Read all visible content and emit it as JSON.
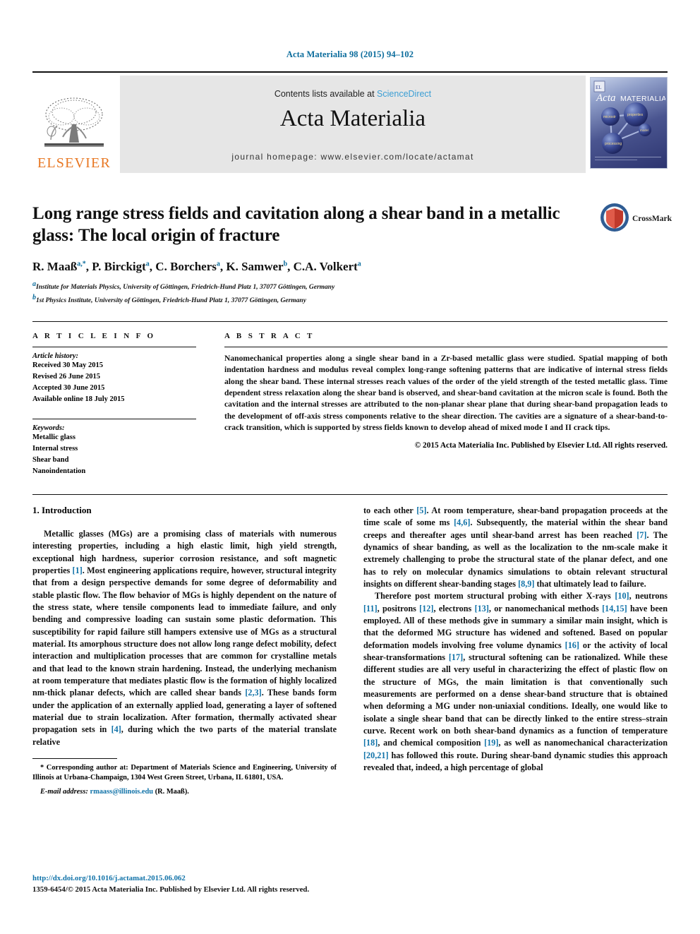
{
  "running_head": "Acta Materialia 98 (2015) 94–102",
  "masthead": {
    "publisher_logo_name": "elsevier-tree-logo",
    "publisher_wordmark": "ELSEVIER",
    "contents_prefix": "Contents lists available at ",
    "contents_link": "ScienceDirect",
    "journal_title": "Acta Materialia",
    "homepage": "journal homepage: www.elsevier.com/locate/actamat",
    "cover": {
      "brand_italic": "Acta",
      "brand_caps": "MATERIALIA",
      "node_labels": [
        "microstructure",
        "properties",
        "modeling",
        "processing"
      ]
    },
    "colors": {
      "link": "#3b9ed4",
      "elsevier_orange": "#e87722",
      "band_bg": "#e6e6e6"
    }
  },
  "title_block": {
    "title": "Long range stress fields and cavitation along a shear band in a metallic glass: The local origin of fracture",
    "crossmark_label": "CrossMark",
    "authors": [
      {
        "name": "R. Maaß",
        "marks": "a,*"
      },
      {
        "name": "P. Birckigt",
        "marks": "a"
      },
      {
        "name": "C. Borchers",
        "marks": "a"
      },
      {
        "name": "K. Samwer",
        "marks": "b"
      },
      {
        "name": "C.A. Volkert",
        "marks": "a"
      }
    ],
    "affiliations": [
      {
        "mark": "a",
        "text": "Institute for Materials Physics, University of Göttingen, Friedrich-Hund Platz 1, 37077 Göttingen, Germany"
      },
      {
        "mark": "b",
        "text": "1st Physics Institute, University of Göttingen, Friedrich-Hund Platz 1, 37077 Göttingen, Germany"
      }
    ]
  },
  "article_info": {
    "heading": "A R T I C L E   I N F O",
    "history_label": "Article history:",
    "history": [
      "Received 30 May 2015",
      "Revised 26 June 2015",
      "Accepted 30 June 2015",
      "Available online 18 July 2015"
    ],
    "keywords_label": "Keywords:",
    "keywords": [
      "Metallic glass",
      "Internal stress",
      "Shear band",
      "Nanoindentation"
    ]
  },
  "abstract": {
    "heading": "A B S T R A C T",
    "text": "Nanomechanical properties along a single shear band in a Zr-based metallic glass were studied. Spatial mapping of both indentation hardness and modulus reveal complex long-range softening patterns that are indicative of internal stress fields along the shear band. These internal stresses reach values of the order of the yield strength of the tested metallic glass. Time dependent stress relaxation along the shear band is observed, and shear-band cavitation at the micron scale is found. Both the cavitation and the internal stresses are attributed to the non-planar shear plane that during shear-band propagation leads to the development of off-axis stress components relative to the shear direction. The cavities are a signature of a shear-band-to-crack transition, which is supported by stress fields known to develop ahead of mixed mode I and II crack tips.",
    "copyright": "© 2015 Acta Materialia Inc. Published by Elsevier Ltd. All rights reserved."
  },
  "body": {
    "section_heading": "1. Introduction",
    "left_paragraph_1_a": "Metallic glasses (MGs) are a promising class of materials with numerous interesting properties, including a high elastic limit, high yield strength, exceptional high hardness, superior corrosion resistance, and soft magnetic properties ",
    "ref_1": "[1]",
    "left_paragraph_1_b": ". Most engineering applications require, however, structural integrity that from a design perspective demands for some degree of deformability and stable plastic flow. The flow behavior of MGs is highly dependent on the nature of the stress state, where tensile components lead to immediate failure, and only bending and compressive loading can sustain some plastic deformation. This susceptibility for rapid failure still hampers extensive use of MGs as a structural material. Its amorphous structure does not allow long range defect mobility, defect interaction and multiplication processes that are common for crystalline metals and that lead to the known strain hardening. Instead, the underlying mechanism at room temperature that mediates plastic flow is the formation of highly localized nm-thick planar defects, which are called shear bands ",
    "ref_23": "[2,3]",
    "left_paragraph_1_c": ". These bands form under the application of an externally applied load, generating a layer of softened material due to strain localization. After formation, thermally activated shear propagation sets in ",
    "ref_4": "[4]",
    "left_paragraph_1_d": ", during which the two parts of the material translate relative",
    "footnote_star": "*",
    "footnote_text": " Corresponding author at: Department of Materials Science and Engineering, University of Illinois at Urbana-Champaign, 1304 West Green Street, Urbana, IL 61801, USA.",
    "email_label": "E-mail address:",
    "email_address": "rmaass@illinois.edu",
    "email_suffix": " (R. Maaß).",
    "right_paragraph_1_a": "to each other ",
    "ref_5": "[5]",
    "right_paragraph_1_b": ". At room temperature, shear-band propagation proceeds at the time scale of some ms ",
    "ref_46": "[4,6]",
    "right_paragraph_1_c": ". Subsequently, the material within the shear band creeps and thereafter ages until shear-band arrest has been reached ",
    "ref_7": "[7]",
    "right_paragraph_1_d": ". The dynamics of shear banding, as well as the localization to the nm-scale make it extremely challenging to probe the structural state of the planar defect, and one has to rely on molecular dynamics simulations to obtain relevant structural insights on different shear-banding stages ",
    "ref_89": "[8,9]",
    "right_paragraph_1_e": " that ultimately lead to failure.",
    "right_paragraph_2_a": "Therefore post mortem structural probing with either X-rays ",
    "ref_10": "[10]",
    "right_paragraph_2_b": ", neutrons ",
    "ref_11": "[11]",
    "right_paragraph_2_c": ", positrons ",
    "ref_12": "[12]",
    "right_paragraph_2_d": ", electrons ",
    "ref_13": "[13]",
    "right_paragraph_2_e": ", or nanomechanical methods ",
    "ref_1415": "[14,15]",
    "right_paragraph_2_f": " have been employed. All of these methods give in summary a similar main insight, which is that the deformed MG structure has widened and softened. Based on popular deformation models involving free volume dynamics ",
    "ref_16": "[16]",
    "right_paragraph_2_g": " or the activity of local shear-transformations ",
    "ref_17": "[17]",
    "right_paragraph_2_h": ", structural softening can be rationalized. While these different studies are all very useful in characterizing the effect of plastic flow on the structure of MGs, the main limitation is that conventionally such measurements are performed on a dense shear-band structure that is obtained when deforming a MG under non-uniaxial conditions. Ideally, one would like to isolate a single shear band that can be directly linked to the entire stress–strain curve. Recent work on both shear-band dynamics as a function of temperature ",
    "ref_18": "[18]",
    "right_paragraph_2_i": ", and chemical composition ",
    "ref_19": "[19]",
    "right_paragraph_2_j": ", as well as nanomechanical characterization ",
    "ref_2021": "[20,21]",
    "right_paragraph_2_k": " has followed this route. During shear-band dynamic studies this approach revealed that, indeed, a high percentage of global"
  },
  "footer": {
    "doi": "http://dx.doi.org/10.1016/j.actamat.2015.06.062",
    "issn": "1359-6454/© 2015 Acta Materialia Inc. Published by Elsevier Ltd. All rights reserved."
  }
}
